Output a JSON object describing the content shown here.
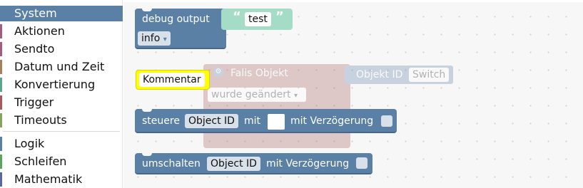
{
  "toolbox": {
    "items": [
      {
        "label": "System",
        "color": "#5b80a5",
        "selected": true
      },
      {
        "label": "Aktionen",
        "color": "#a55b80"
      },
      {
        "label": "Sendto",
        "color": "#a55b80"
      },
      {
        "label": "Datum und Zeit",
        "color": "#a5805b"
      },
      {
        "label": "Konvertierung",
        "color": "#5ba58c"
      },
      {
        "label": "Trigger",
        "color": "#a55b5b"
      },
      {
        "label": "Timeouts",
        "color": "#80a55b"
      },
      {
        "label": "Logik",
        "color": "#5b80a5"
      },
      {
        "label": "Schleifen",
        "color": "#5ba55b"
      },
      {
        "label": "Mathematik",
        "color": "#5b67a5"
      }
    ]
  },
  "workspace": {
    "debug": {
      "label": "debug output",
      "string_value": "test",
      "level": "info"
    },
    "comment": {
      "label": "Kommentar"
    },
    "event_faded": {
      "title": "Falls Objekt",
      "object_label": "Objekt ID",
      "object_value": "Switch",
      "trigger": "wurde geändert"
    },
    "control": {
      "prefix": "steuere",
      "object_field": "Object ID",
      "with": "mit",
      "delay": "mit Verzögerung"
    },
    "toggle": {
      "prefix": "umschalten",
      "object_field": "Object ID",
      "delay": "mit Verzögerung"
    }
  },
  "colors": {
    "system_block": "#5b80a5",
    "string_block": "#a5dcc8",
    "comment_highlight": "#ffff00",
    "event_block": "#a55b5b"
  }
}
